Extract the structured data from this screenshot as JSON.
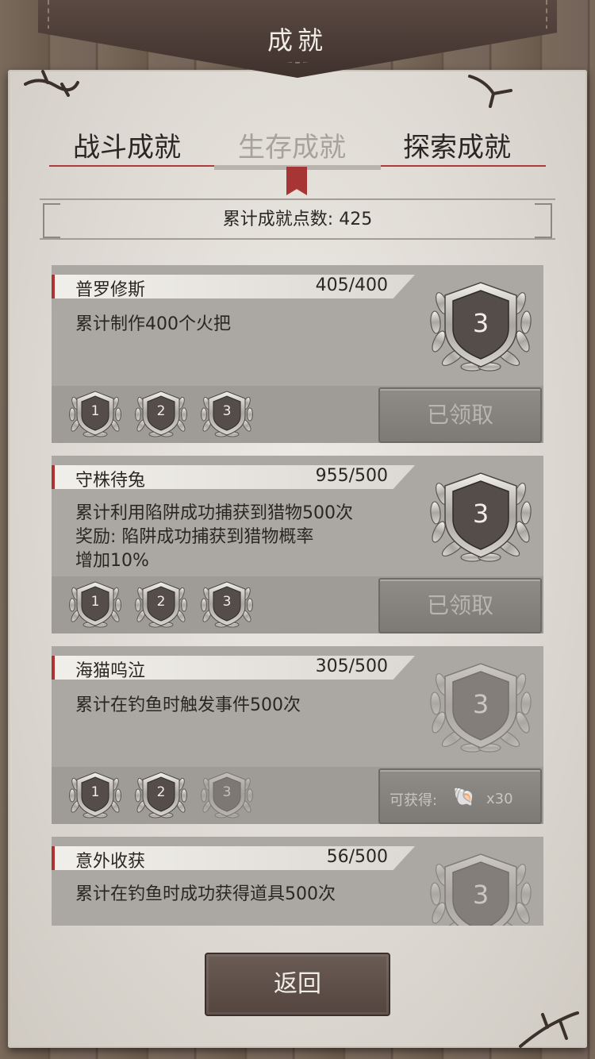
{
  "header": {
    "title": "成就"
  },
  "tabs": [
    {
      "label": "战斗成就",
      "active": false
    },
    {
      "label": "生存成就",
      "active": true
    },
    {
      "label": "探索成就",
      "active": false
    }
  ],
  "summary": {
    "text": "累计成就点数: 425"
  },
  "achievements": [
    {
      "name": "普罗修斯",
      "progress": "405/400",
      "desc": [
        "累计制作400个火把"
      ],
      "level": "3",
      "tiers": [
        "1",
        "2",
        "3"
      ],
      "tiers_earned": 3,
      "button": {
        "type": "claimed",
        "label": "已领取"
      }
    },
    {
      "name": "守株待兔",
      "progress": "955/500",
      "desc": [
        "累计利用陷阱成功捕获到猎物500次",
        "奖励: 陷阱成功捕获到猎物概率",
        "增加10%"
      ],
      "level": "3",
      "tiers": [
        "1",
        "2",
        "3"
      ],
      "tiers_earned": 3,
      "button": {
        "type": "claimed",
        "label": "已领取"
      }
    },
    {
      "name": "海猫呜泣",
      "progress": "305/500",
      "desc": [
        "累计在钓鱼时触发事件500次"
      ],
      "level": "3",
      "tiers": [
        "1",
        "2",
        "3"
      ],
      "tiers_earned": 2,
      "button": {
        "type": "reward",
        "label": "可获得:",
        "icon": "shell-icon",
        "qty": "x30"
      }
    },
    {
      "name": "意外收获",
      "progress": "56/500",
      "desc": [
        "累计在钓鱼时成功获得道具500次"
      ],
      "level": "3"
    }
  ],
  "footer": {
    "back_label": "返回"
  },
  "colors": {
    "accent_red": "#a83535",
    "paper": "#e3e0da",
    "card": "#aba8a3"
  }
}
